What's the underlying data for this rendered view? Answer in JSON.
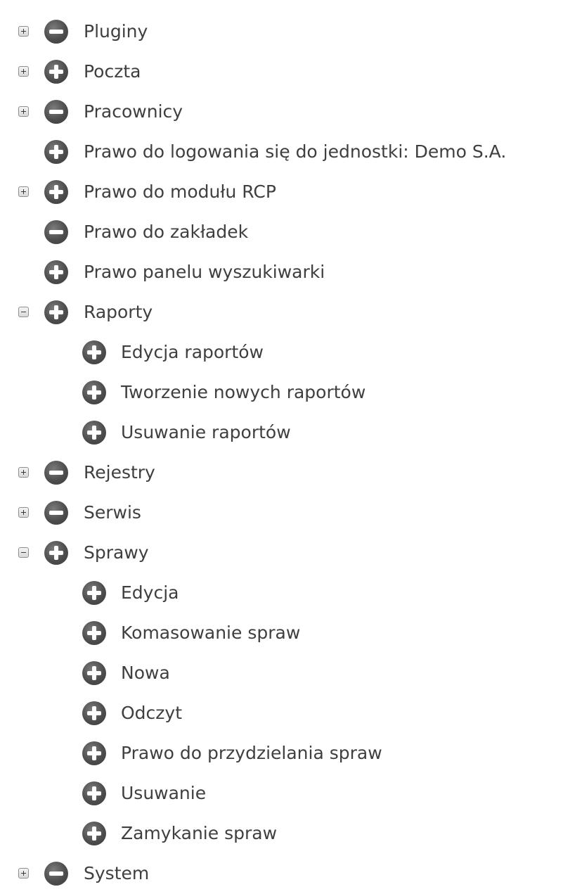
{
  "tree": {
    "items": [
      {
        "label": "Pluginy",
        "level": 0,
        "expander": "plus",
        "icon": "minus-circle-icon"
      },
      {
        "label": "Poczta",
        "level": 0,
        "expander": "plus",
        "icon": "plus-circle-icon"
      },
      {
        "label": "Pracownicy",
        "level": 0,
        "expander": "plus",
        "icon": "minus-circle-icon"
      },
      {
        "label": "Prawo do logowania się do jednostki: Demo S.A.",
        "level": 0,
        "expander": "none",
        "icon": "plus-circle-icon"
      },
      {
        "label": "Prawo do modułu RCP",
        "level": 0,
        "expander": "plus",
        "icon": "plus-circle-icon"
      },
      {
        "label": "Prawo do zakładek",
        "level": 0,
        "expander": "none",
        "icon": "minus-circle-icon"
      },
      {
        "label": "Prawo panelu wyszukiwarki",
        "level": 0,
        "expander": "none",
        "icon": "plus-circle-icon"
      },
      {
        "label": "Raporty",
        "level": 0,
        "expander": "minus",
        "icon": "plus-circle-icon"
      },
      {
        "label": "Edycja raportów",
        "level": 1,
        "expander": "none",
        "icon": "plus-circle-icon"
      },
      {
        "label": "Tworzenie nowych raportów",
        "level": 1,
        "expander": "none",
        "icon": "plus-circle-icon"
      },
      {
        "label": "Usuwanie raportów",
        "level": 1,
        "expander": "none",
        "icon": "plus-circle-icon"
      },
      {
        "label": "Rejestry",
        "level": 0,
        "expander": "plus",
        "icon": "minus-circle-icon"
      },
      {
        "label": "Serwis",
        "level": 0,
        "expander": "plus",
        "icon": "minus-circle-icon"
      },
      {
        "label": "Sprawy",
        "level": 0,
        "expander": "minus",
        "icon": "plus-circle-icon"
      },
      {
        "label": "Edycja",
        "level": 1,
        "expander": "none",
        "icon": "plus-circle-icon"
      },
      {
        "label": "Komasowanie spraw",
        "level": 1,
        "expander": "none",
        "icon": "plus-circle-icon"
      },
      {
        "label": "Nowa",
        "level": 1,
        "expander": "none",
        "icon": "plus-circle-icon"
      },
      {
        "label": "Odczyt",
        "level": 1,
        "expander": "none",
        "icon": "plus-circle-icon"
      },
      {
        "label": "Prawo do przydzielania spraw",
        "level": 1,
        "expander": "none",
        "icon": "plus-circle-icon"
      },
      {
        "label": "Usuwanie",
        "level": 1,
        "expander": "none",
        "icon": "plus-circle-icon"
      },
      {
        "label": "Zamykanie spraw",
        "level": 1,
        "expander": "none",
        "icon": "plus-circle-icon"
      },
      {
        "label": "System",
        "level": 0,
        "expander": "plus",
        "icon": "minus-circle-icon"
      }
    ]
  }
}
